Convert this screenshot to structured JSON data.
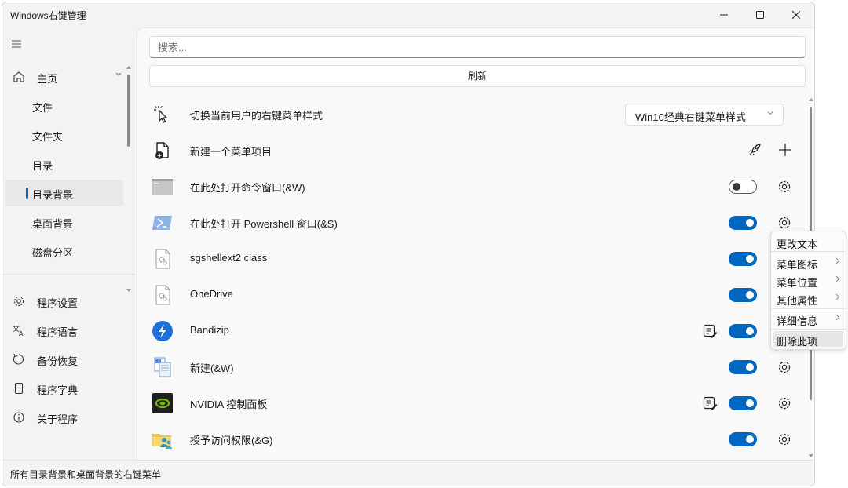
{
  "window": {
    "title": "Windows右键管理"
  },
  "sidebar": {
    "items": [
      {
        "label": "主页"
      },
      {
        "label": "文件"
      },
      {
        "label": "文件夹"
      },
      {
        "label": "目录"
      },
      {
        "label": "目录背景"
      },
      {
        "label": "桌面背景"
      },
      {
        "label": "磁盘分区"
      }
    ],
    "footer_items": [
      {
        "label": "程序设置",
        "icon": "gear-icon"
      },
      {
        "label": "程序语言",
        "icon": "language-icon"
      },
      {
        "label": "备份恢复",
        "icon": "restore-icon"
      },
      {
        "label": "程序字典",
        "icon": "dictionary-icon"
      },
      {
        "label": "关于程序",
        "icon": "info-icon"
      }
    ]
  },
  "main": {
    "search_placeholder": "搜索...",
    "refresh_label": "刷新",
    "rows": [
      {
        "label": "切换当前用户的右键菜单样式",
        "dropdown_value": "Win10经典右键菜单样式"
      },
      {
        "label": "新建一个菜单项目"
      },
      {
        "label": "在此处打开命令窗口(&W)",
        "enabled": false
      },
      {
        "label": "在此处打开 Powershell 窗口(&S)",
        "enabled": true
      },
      {
        "label": "sgshellext2 class",
        "enabled": true
      },
      {
        "label": "OneDrive",
        "enabled": true
      },
      {
        "label": "Bandizip",
        "enabled": true
      },
      {
        "label": "新建(&W)",
        "enabled": true
      },
      {
        "label": "NVIDIA 控制面板",
        "enabled": true
      },
      {
        "label": "授予访问权限(&G)",
        "enabled": true
      }
    ]
  },
  "context_menu": {
    "items": [
      {
        "label": "更改文本"
      },
      {
        "label": "菜单图标"
      },
      {
        "label": "菜单位置"
      },
      {
        "label": "其他属性"
      },
      {
        "label": "详细信息"
      },
      {
        "label": "删除此项"
      }
    ]
  },
  "statusbar": {
    "text": "所有目录背景和桌面背景的右键菜单"
  },
  "colors": {
    "accent": "#0067c0",
    "nvidia": "#76b900",
    "bandizip": "#1e6fd9"
  }
}
